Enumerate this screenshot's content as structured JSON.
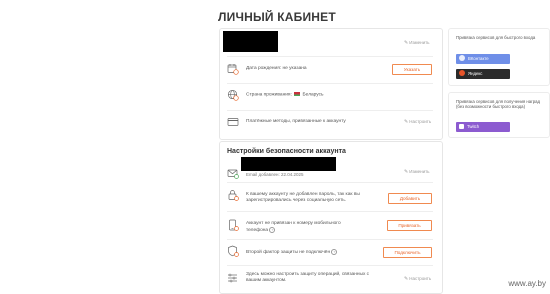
{
  "page": {
    "title": "ЛИЧНЫЙ КАБИНЕТ"
  },
  "profile": {
    "edit_label": "Изменить",
    "birthdate_text": "Дата рождения: не указана",
    "birthdate_button": "Указать",
    "country_text": "Страна проживания:",
    "country_value": "Беларусь",
    "payment_text": "Платёжные методы, привязанные к аккаунту",
    "payment_edit": "Настроить"
  },
  "security": {
    "title": "Настройки безопасности аккаунта",
    "email_added": "Email добавлен: 22.04.2025",
    "email_edit": "Изменить",
    "password_text": "К вашему аккаунту не добавлен пароль, так как вы зарегистрировались через социальную сеть.",
    "password_button": "Добавить",
    "phone_text": "Аккаунт не привязан к номеру мобильного телефона",
    "phone_button": "Привязать",
    "twofactor_text": "Второй фактор защиты не подключён",
    "twofactor_button": "Подключить",
    "operations_text": "Здесь можно настроить защиту операций, связанных с вашим аккаунтом.",
    "operations_edit": "Настроить"
  },
  "right_panel": {
    "login_title": "Привязка сервисов для быстрого входа",
    "vk_label": "ВКонтакте",
    "yandex_label": "Яндекс",
    "rewards_title": "Привязка сервисов для получения наград (без возможности быстрого входа)",
    "twitch_label": "Twitch"
  },
  "colors": {
    "accent": "#e8652a",
    "vk": "#6f8fe8",
    "yandex": "#2b2b2b",
    "twitch": "#8c5bd0"
  },
  "icons": {
    "calendar": "calendar-icon",
    "globe": "globe-icon",
    "card": "credit-card-icon",
    "mail": "mail-icon",
    "lock": "lock-icon",
    "phone": "phone-icon",
    "shield": "shield-icon",
    "settings": "sliders-icon"
  },
  "watermark": "www.ay.by"
}
